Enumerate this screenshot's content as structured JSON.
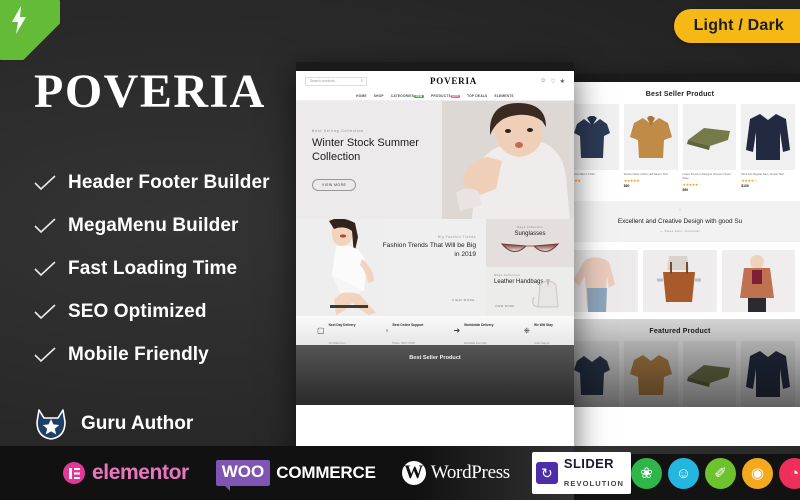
{
  "badge": {
    "ribbon_icon": "lightning-bolt-icon",
    "light_dark_label": "Light / Dark"
  },
  "brand": {
    "name": "POVERIA"
  },
  "features": [
    {
      "label": "Header Footer Builder"
    },
    {
      "label": "MegaMenu Builder"
    },
    {
      "label": "Fast Loading Time"
    },
    {
      "label": "SEO Optimized"
    },
    {
      "label": "Mobile Friendly"
    }
  ],
  "author": {
    "label": "Guru Author",
    "icon": "cat-star-badge-icon"
  },
  "logobar": {
    "elementor": "elementor",
    "woo_mark": "WOO",
    "woo_text": "COMMERCE",
    "wp_mark": "W",
    "wp_text": "WordPress",
    "slider_icon": "refresh-icon",
    "slider_line1": "SLIDER",
    "slider_line2": "REVOLUTION",
    "dots": [
      {
        "name": "hand-icon",
        "glyph": "❀",
        "color": "#2fb54a"
      },
      {
        "name": "smiley-chat-icon",
        "glyph": "☺",
        "color": "#23b6e0"
      },
      {
        "name": "microphone-icon",
        "glyph": "✐",
        "color": "#6dc22e"
      },
      {
        "name": "eye-icon",
        "glyph": "◉",
        "color": "#f4a81d"
      },
      {
        "name": "speedometer-icon",
        "glyph": "◔",
        "color": "#ef2f5b"
      },
      {
        "name": "rocket-icon",
        "glyph": "➤",
        "color": "#1f7fe0"
      },
      {
        "name": "share-icon",
        "glyph": "❦",
        "color": "#1ec8bf"
      }
    ]
  },
  "site": {
    "search_placeholder": "Search products...",
    "search_icon": "search-icon",
    "logo": "POVERIA",
    "header_icons": [
      "account-icon",
      "wishlist-icon",
      "cart-icon"
    ],
    "nav": [
      {
        "label": "HOME",
        "badge": "",
        "badge_color": ""
      },
      {
        "label": "SHOP",
        "badge": "",
        "badge_color": ""
      },
      {
        "label": "CATEGORIES",
        "badge": "NEW",
        "badge_color": "#4caf50"
      },
      {
        "label": "PRODUCTS",
        "badge": "HOT",
        "badge_color": "#f06292"
      },
      {
        "label": "TOP DEALS",
        "badge": "",
        "badge_color": ""
      },
      {
        "label": "ELEMENTS",
        "badge": "",
        "badge_color": ""
      }
    ],
    "hero": {
      "eyebrow": "Best Selling Collection",
      "title": "Winter Stock Summer Collection",
      "button": "VIEW MORE"
    },
    "promo_mid": {
      "eyebrow": "Big Fashion Trends",
      "title": "Fashion Trends That Will be Big in 2019",
      "button": "VIEW MORE"
    },
    "promo_sunglasses": {
      "eyebrow": "Mega Collection",
      "title": "Sunglasses"
    },
    "promo_handbags": {
      "eyebrow": "Mega Collection",
      "title": "Leather Handbags",
      "button": "VIEW MORE"
    },
    "services": [
      {
        "icon": "truck-icon",
        "title": "Next Day Delivery",
        "sub": "On Orders Over"
      },
      {
        "icon": "headphone-icon",
        "title": "Best Online Support",
        "sub": "Phone : 0876 7 8765"
      },
      {
        "icon": "shipping-icon",
        "title": "Worldwide Delivery",
        "sub": "Worldwide Free Ship"
      },
      {
        "icon": "power-icon",
        "title": "We Will Stay",
        "sub": "Under Stay 24"
      }
    ],
    "footer_title": "Best Seller Product"
  },
  "site_right": {
    "best_seller_title": "Best Seller Product",
    "featured_title": "Featured Product",
    "products": [
      {
        "name": "Classic Polo Men's T-shirt",
        "stars": "★★★★★",
        "price": "$40",
        "color": "#2c3a55",
        "shape": "polo"
      },
      {
        "name": "Woolen Mens Cotton Half Sleeve Shirt",
        "stars": "★★★★★",
        "price": "$60",
        "color": "#c08a47",
        "shape": "shirt"
      },
      {
        "name": "Cotton Premium Designer Women's Scarf Wrap",
        "stars": "★★★★★",
        "price": "$90",
        "color": "#767a4a",
        "shape": "folded"
      },
      {
        "name": "Wool Knit Regular Navy Jumper Shirt",
        "stars": "★★★★☆",
        "price": "$109",
        "color": "#222a42",
        "shape": "sweater"
      }
    ],
    "quote": {
      "mark": "“",
      "text": "Excellent and Creative Design with good Su",
      "author": "—  Steve John, Customer"
    },
    "lifestyle": [
      {
        "name": "pink-blouse-photo",
        "color": "#e7c9bb"
      },
      {
        "name": "leather-tote-photo",
        "color": "#a05a2c"
      },
      {
        "name": "rust-cardigan-photo",
        "color": "#c0714f"
      }
    ]
  }
}
